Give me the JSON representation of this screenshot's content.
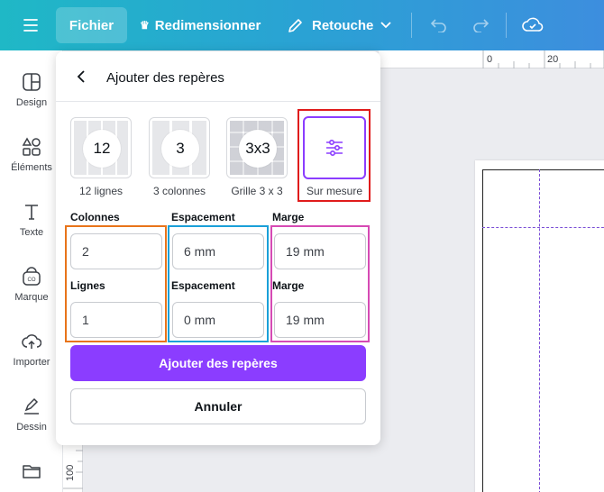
{
  "topbar": {
    "menu_icon": "hamburger-icon",
    "file_label": "Fichier",
    "resize_label": "Redimensionner",
    "retouch_label": "Retouche",
    "undo_icon": "undo-icon",
    "redo_icon": "redo-icon",
    "cloud_icon": "cloud-check-icon"
  },
  "sidebar": {
    "items": [
      {
        "label": "Design",
        "icon": "layout-icon"
      },
      {
        "label": "Éléments",
        "icon": "shapes-icon"
      },
      {
        "label": "Texte",
        "icon": "text-icon"
      },
      {
        "label": "Marque",
        "icon": "brand-icon"
      },
      {
        "label": "Importer",
        "icon": "upload-icon"
      },
      {
        "label": "Dessin",
        "icon": "pen-icon"
      },
      {
        "label": "",
        "icon": "folder-icon"
      }
    ]
  },
  "rulers": {
    "top_ticks": [
      "0",
      "20"
    ],
    "left_tick": "100"
  },
  "panel": {
    "title": "Ajouter des repères",
    "presets": [
      {
        "badge": "12",
        "label": "12 lignes"
      },
      {
        "badge": "3",
        "label": "3 colonnes"
      },
      {
        "badge": "3x3",
        "label": "Grille 3 x 3"
      },
      {
        "badge": "",
        "label": "Sur mesure",
        "icon": "sliders-icon"
      }
    ],
    "columns": {
      "label": "Colonnes",
      "value": "2",
      "rows_label": "Lignes",
      "rows_value": "1"
    },
    "spacing": {
      "label": "Espacement",
      "value": "6 mm",
      "rows_label": "Espacement",
      "rows_value": "0 mm"
    },
    "margin": {
      "label": "Marge",
      "value": "19 mm",
      "rows_label": "Marge",
      "rows_value": "19 mm"
    },
    "add_button": "Ajouter des repères",
    "cancel_button": "Annuler"
  },
  "colors": {
    "accent": "#8b3dff",
    "highlight_red": "#e01c1c",
    "highlight_orange": "#e8741a",
    "highlight_blue": "#1aa0d8",
    "highlight_pink": "#d64ab4"
  }
}
